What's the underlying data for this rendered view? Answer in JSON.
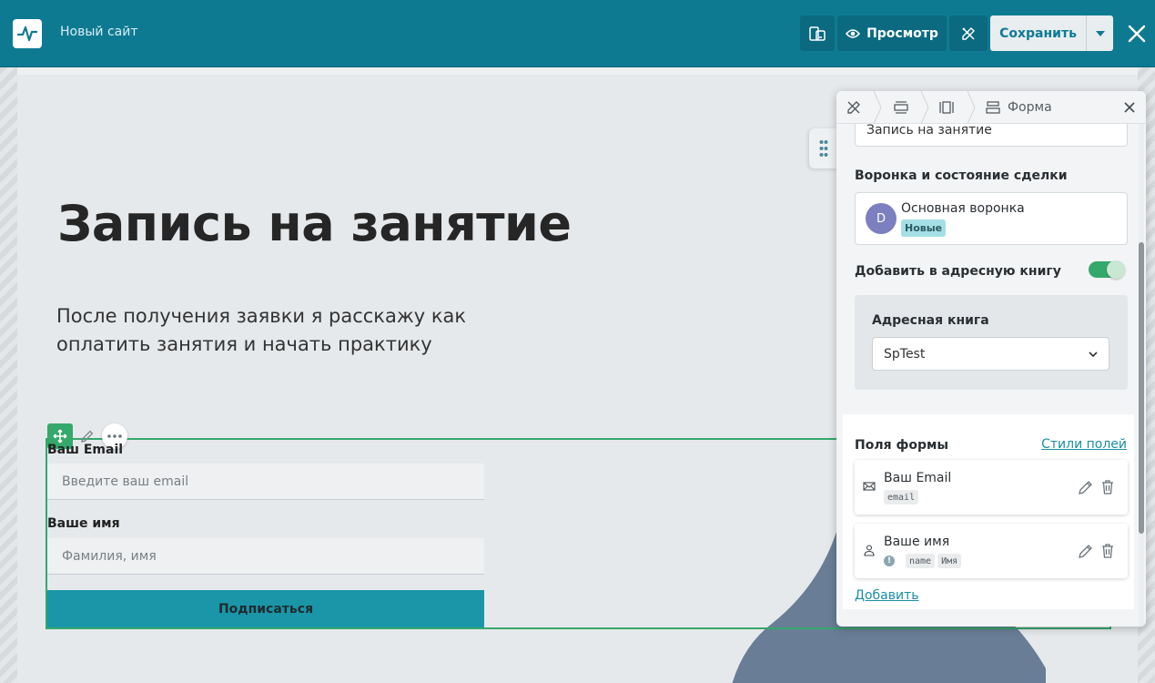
{
  "topbar": {
    "site_name": "Новый сайт",
    "preview_label": "Просмотр",
    "save_label": "Сохранить"
  },
  "hero": {
    "title": "Запись на занятие",
    "subtitle": "После получения заявки я расскажу как оплатить занятия и начать практику"
  },
  "form": {
    "email_label": "Ваш Email",
    "email_placeholder": "Введите ваш email",
    "name_label": "Ваше имя",
    "name_placeholder": "Фамилия, имя",
    "submit_label": "Подписаться"
  },
  "panel": {
    "breadcrumb_current": "Форма",
    "top_input_value": "Запись на занятие",
    "funnel_heading": "Воронка и состояние сделки",
    "funnel_avatar": "D",
    "funnel_name": "Основная воронка",
    "funnel_badge": "Новые",
    "addressbook_toggle_label": "Добавить в адресную книгу",
    "addressbook_toggle_on": true,
    "addressbook_label": "Адресная книга",
    "addressbook_selected": "SpTest",
    "fields_title": "Поля формы",
    "fields_styles_link": "Стили полей",
    "fields": [
      {
        "name": "Ваш Email",
        "tags": [
          "email"
        ],
        "icon": "envelope-icon"
      },
      {
        "name": "Ваше имя",
        "tags": [
          "name",
          "Имя"
        ],
        "icon": "person-icon"
      }
    ],
    "add_link": "Добавить"
  },
  "colors": {
    "topbar_bg": "#0e7a92",
    "accent_green": "#35a86b",
    "submit_bg": "#1a96a8",
    "link": "#1a8fa3"
  }
}
